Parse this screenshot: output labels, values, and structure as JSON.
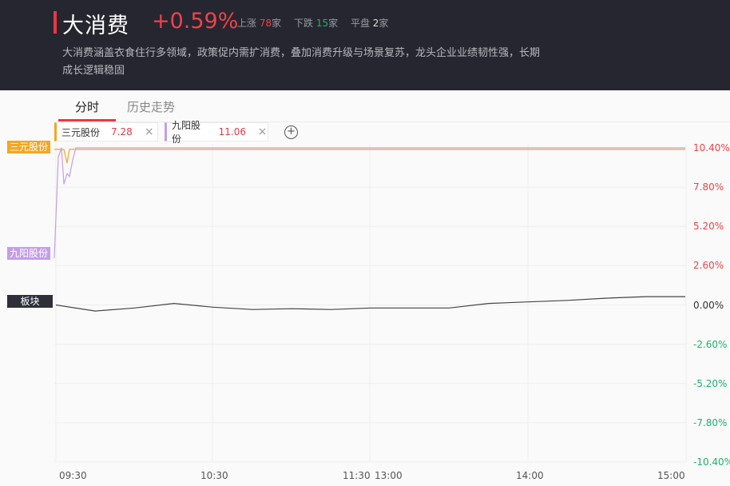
{
  "header": {
    "title": "大消费",
    "change": "+0.59%",
    "stats": {
      "up_label": "上涨",
      "up_count": "78",
      "down_label": "下跌",
      "down_count": "15",
      "flat_label": "平盘",
      "flat_count": "2",
      "unit": "家"
    },
    "description": "大消费涵盖衣食住行多领域，政策促内需扩消费，叠加消费升级与场景复苏，龙头企业业绩韧性强，长期成长逻辑稳固"
  },
  "tabs": [
    {
      "label": "分时",
      "active": true
    },
    {
      "label": "历史走势",
      "active": false
    }
  ],
  "stocks": [
    {
      "name": "三元股份",
      "value": "7.28",
      "color": "#f5a623"
    },
    {
      "name": "九阳股份",
      "value": "11.06",
      "color": "#c49ee8"
    }
  ],
  "add_symbol": "+",
  "close_symbol": "×",
  "sector_label": "板块",
  "chart_data": {
    "type": "line",
    "y_ticks": [
      "10.40%",
      "7.80%",
      "5.20%",
      "2.60%",
      "0.00%",
      "-2.60%",
      "-5.20%",
      "-7.80%",
      "-10.40%"
    ],
    "y_tick_colors": {
      "positive": "#f0424a",
      "zero": "#333333",
      "negative": "#1eb26a"
    },
    "ylim": [
      -10.4,
      10.4
    ],
    "x_ticks": [
      "09:30",
      "10:30",
      "11:30",
      "13:00",
      "14:00",
      "15:00"
    ],
    "series": [
      {
        "name": "三元股份",
        "color": "#f5a623",
        "values": [
          10.3,
          10.3,
          10.3,
          10.3,
          9.4,
          10.3,
          10.3,
          10.3,
          10.3,
          10.3,
          10.3,
          10.3,
          10.3,
          10.3
        ]
      },
      {
        "name": "九阳股份",
        "color": "#c49ee8",
        "values": [
          3.1,
          9.8,
          10.4,
          8.0,
          8.7,
          8.5,
          9.6,
          10.4,
          10.4,
          10.4,
          10.4,
          10.4,
          10.4,
          10.4
        ]
      },
      {
        "name": "板块",
        "color": "#444444",
        "values": [
          0.0,
          -0.4,
          -0.2,
          0.1,
          -0.15,
          -0.3,
          -0.25,
          -0.3,
          -0.2,
          -0.2,
          -0.2,
          0.1,
          0.2,
          0.3,
          0.45,
          0.55,
          0.55
        ]
      }
    ]
  }
}
